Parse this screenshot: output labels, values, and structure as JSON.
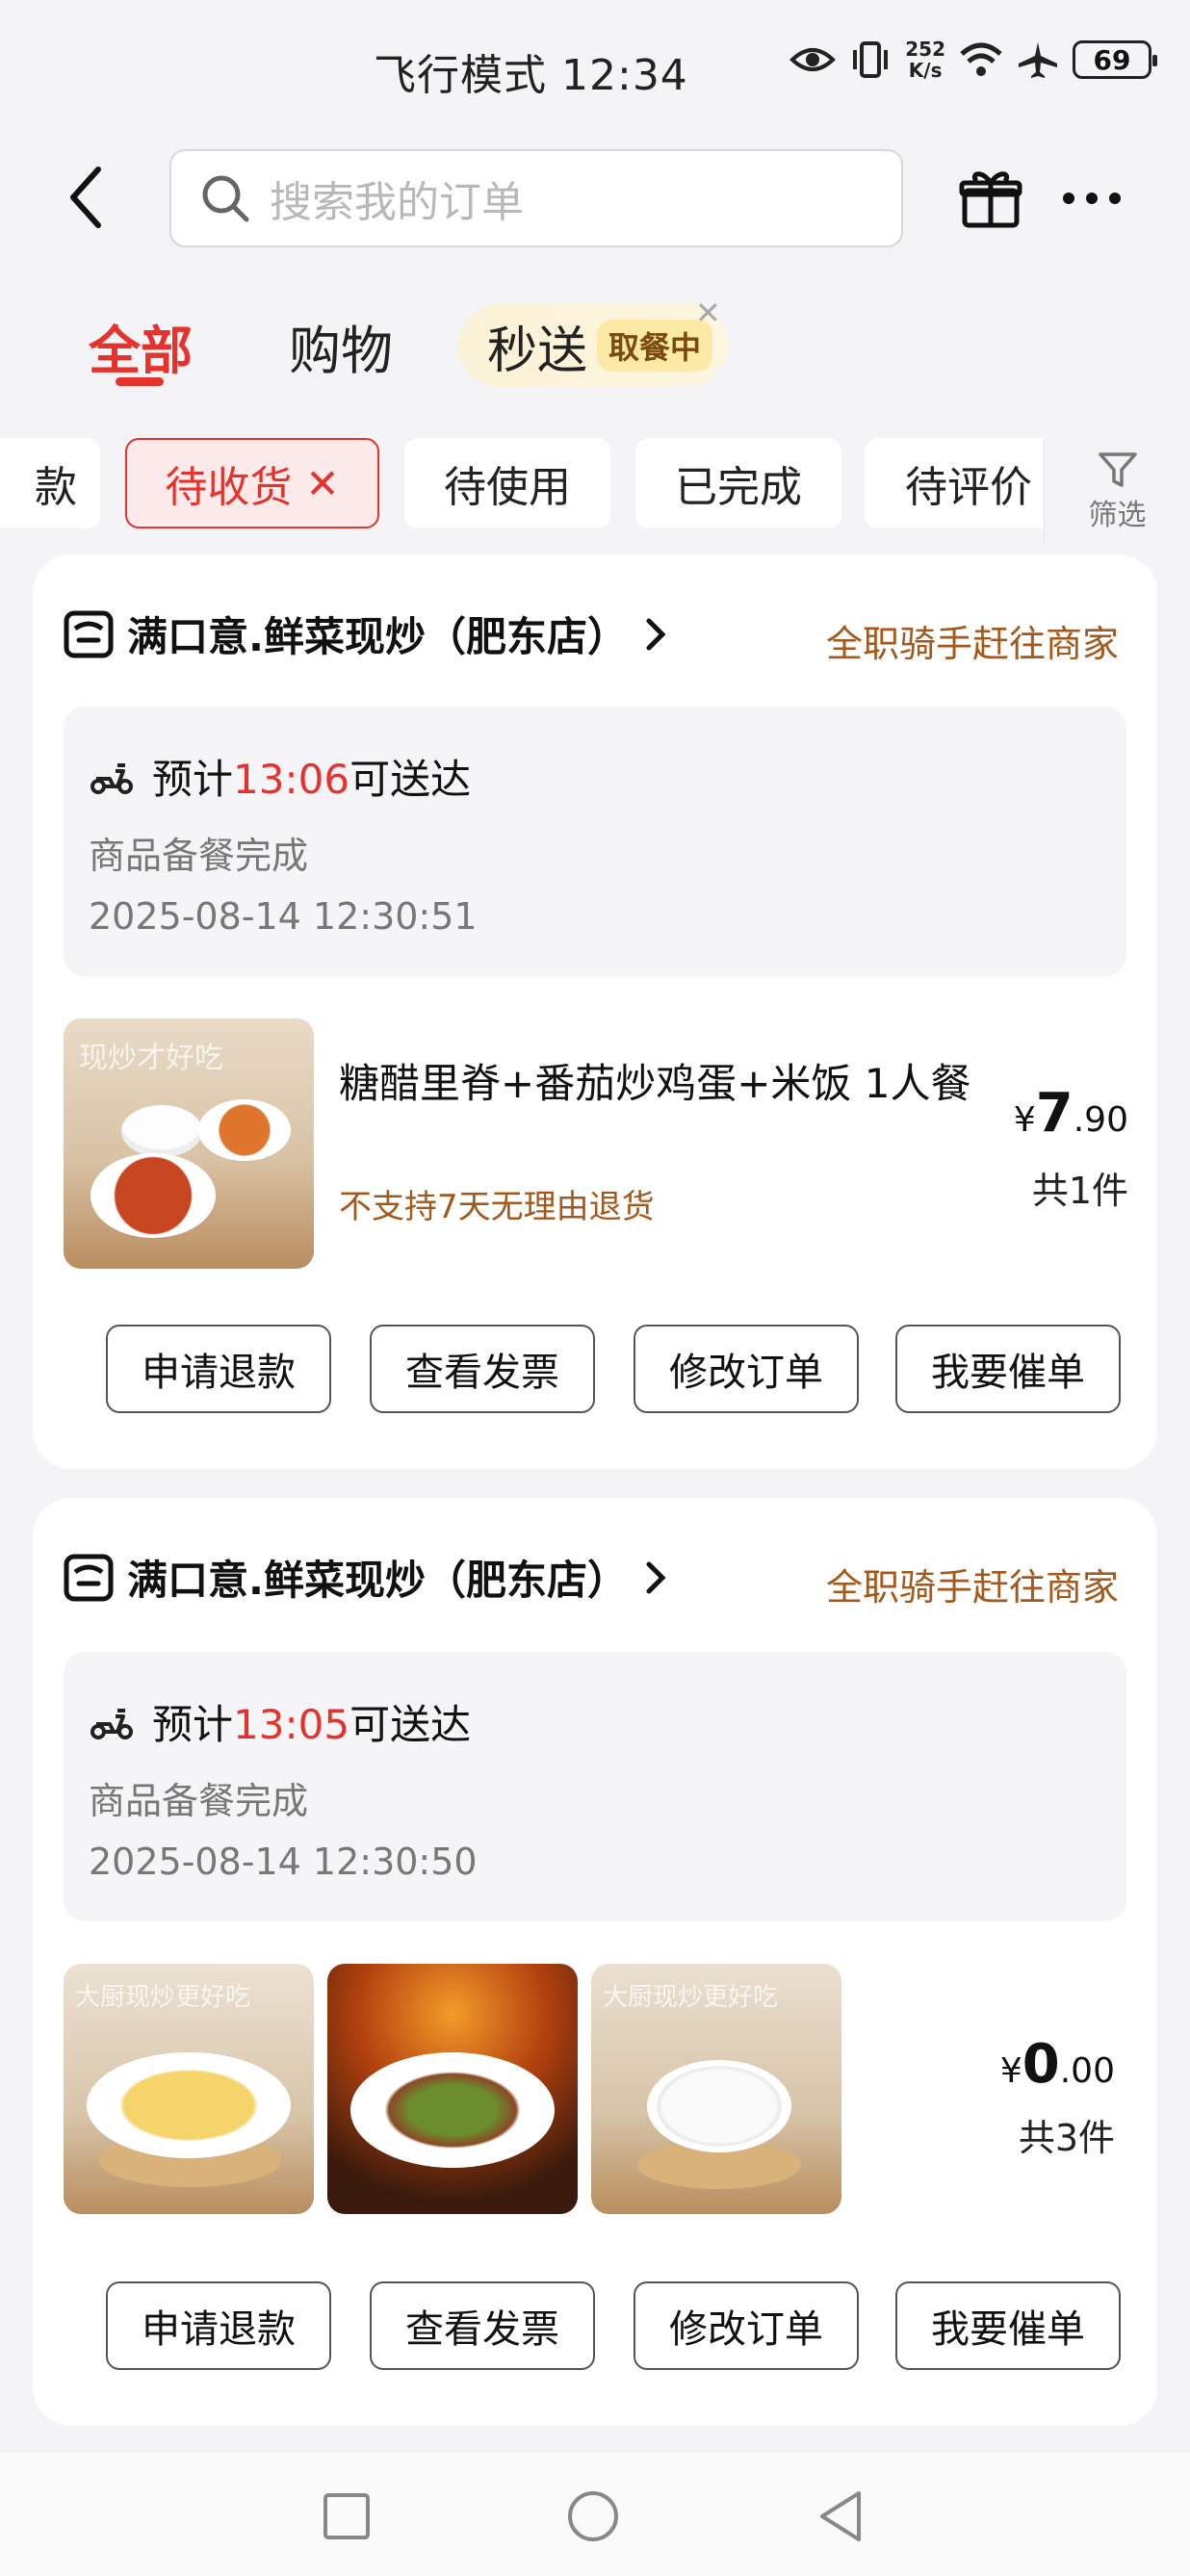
{
  "status_bar": {
    "mode_label": "飞行模式",
    "time": "12:34",
    "speed_value": "252",
    "speed_unit": "K/s",
    "battery": "69"
  },
  "header": {
    "search_placeholder": "搜索我的订单"
  },
  "tabs": [
    {
      "label": "全部",
      "active": true
    },
    {
      "label": "购物",
      "active": false
    }
  ],
  "miaosong": {
    "label": "秒送",
    "badge": "取餐中"
  },
  "chips": [
    {
      "label": "款"
    },
    {
      "label": "待收货",
      "active": true
    },
    {
      "label": "待使用"
    },
    {
      "label": "已完成"
    },
    {
      "label": "待评价"
    }
  ],
  "filter_label": "筛选",
  "orders": [
    {
      "shop_name": "满口意.鲜菜现炒（肥东店）",
      "status": "全职骑手赶往商家",
      "eta_prefix": "预计",
      "eta_time": "13:06",
      "eta_suffix": "可送达",
      "prep_status": "商品备餐完成",
      "timestamp": "2025-08-14 12:30:51",
      "item_name": "糖醋里脊+番茄炒鸡蛋+米饭 1人餐",
      "item_note": "不支持7天无理由退货",
      "price_symbol": "¥",
      "price_int": "7",
      "price_dec": ".90",
      "count": "共1件",
      "thumb_caption": "现炒才好吃",
      "buttons": [
        "申请退款",
        "查看发票",
        "修改订单",
        "我要催单"
      ]
    },
    {
      "shop_name": "满口意.鲜菜现炒（肥东店）",
      "status": "全职骑手赶往商家",
      "eta_prefix": "预计",
      "eta_time": "13:05",
      "eta_suffix": "可送达",
      "prep_status": "商品备餐完成",
      "timestamp": "2025-08-14 12:30:50",
      "price_symbol": "¥",
      "price_int": "0",
      "price_dec": ".00",
      "count": "共3件",
      "thumb_captions": [
        "大厨现炒更好吃",
        "",
        "大厨现炒更好吃"
      ],
      "buttons": [
        "申请退款",
        "查看发票",
        "修改订单",
        "我要催单"
      ]
    }
  ],
  "colors": {
    "accent_red": "#e5322d",
    "brown": "#a4581b",
    "background": "#f4f4f6"
  }
}
